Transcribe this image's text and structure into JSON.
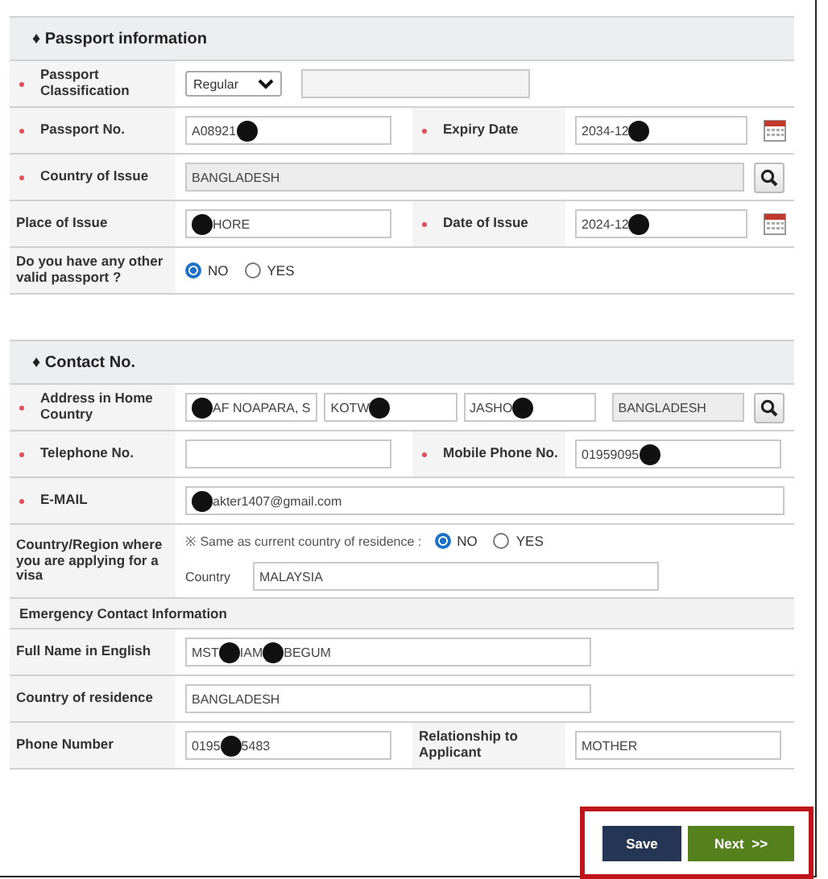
{
  "sections": [
    {
      "title": "♦ Passport information",
      "kind": "main",
      "rows": [
        {
          "kind": "fields",
          "fields": [
            {
              "label": "Passport Classification",
              "required": true,
              "lines": [
                [
                  {
                    "kind": "select",
                    "value": "Regular"
                  },
                  {
                    "kind": "text",
                    "readonly": true
                  }
                ]
              ]
            }
          ]
        },
        {
          "kind": "fields",
          "fields": [
            {
              "label": "Passport No.",
              "required": true,
              "lines": [
                [
                  {
                    "kind": "text",
                    "readonly": false,
                    "value": [
                      {
                        "text": "A08921"
                      },
                      {
                        "kind": "redaction"
                      }
                    ]
                  }
                ]
              ]
            },
            {
              "label": "Expiry Date",
              "required": true,
              "lines": [
                [
                  {
                    "kind": "text",
                    "readonly": false,
                    "value": [
                      {
                        "text": "2034-12"
                      },
                      {
                        "kind": "redaction"
                      }
                    ]
                  },
                  {
                    "kind": "calendar-button"
                  }
                ]
              ]
            }
          ]
        },
        {
          "kind": "fields",
          "fields": [
            {
              "label": "Country of Issue",
              "required": true,
              "lines": [
                [
                  {
                    "kind": "text",
                    "readonly": true,
                    "value": [
                      {
                        "text": "BANGLADESH"
                      }
                    ]
                  },
                  {
                    "kind": "search-button"
                  }
                ]
              ]
            }
          ]
        },
        {
          "kind": "fields",
          "fields": [
            {
              "label": "Place of Issue",
              "required": false,
              "lines": [
                [
                  {
                    "kind": "text",
                    "readonly": false,
                    "value": [
                      {
                        "kind": "redaction"
                      },
                      {
                        "text": "HORE"
                      }
                    ]
                  }
                ]
              ]
            },
            {
              "label": "Date of Issue",
              "required": true,
              "lines": [
                [
                  {
                    "kind": "text",
                    "readonly": false,
                    "value": [
                      {
                        "text": "2024-12"
                      },
                      {
                        "kind": "redaction"
                      }
                    ]
                  },
                  {
                    "kind": "calendar-button"
                  }
                ]
              ]
            }
          ]
        },
        {
          "kind": "fields",
          "fields": [
            {
              "label": "Do you have any other valid passport ?",
              "required": false,
              "lines": [
                [
                  {
                    "kind": "radio",
                    "options": [
                      {
                        "label": "NO",
                        "selected": true
                      },
                      {
                        "label": "YES",
                        "selected": false
                      }
                    ]
                  }
                ]
              ]
            }
          ]
        }
      ]
    },
    {
      "title": "♦ Contact No.",
      "kind": "main",
      "rows": [
        {
          "kind": "fields",
          "fields": [
            {
              "label": "Address in Home Country",
              "required": true,
              "lines": [
                [
                  {
                    "kind": "text",
                    "readonly": false,
                    "value": [
                      {
                        "kind": "redaction"
                      },
                      {
                        "text": "AF NOAPARA, S"
                      }
                    ]
                  },
                  {
                    "kind": "text",
                    "readonly": false,
                    "value": [
                      {
                        "text": "KOTW"
                      },
                      {
                        "kind": "redaction"
                      }
                    ]
                  },
                  {
                    "kind": "text",
                    "readonly": false,
                    "value": [
                      {
                        "text": "JASHO"
                      },
                      {
                        "kind": "redaction"
                      }
                    ]
                  },
                  {
                    "kind": "text",
                    "readonly": true,
                    "value": [
                      {
                        "text": "BANGLADESH"
                      }
                    ]
                  },
                  {
                    "kind": "search-button"
                  }
                ]
              ]
            }
          ]
        },
        {
          "kind": "fields",
          "fields": [
            {
              "label": "Telephone No.",
              "required": true,
              "lines": [
                [
                  {
                    "kind": "text",
                    "readonly": false
                  }
                ]
              ]
            },
            {
              "label": "Mobile Phone No.",
              "required": true,
              "lines": [
                [
                  {
                    "kind": "text",
                    "readonly": false,
                    "value": [
                      {
                        "text": "01959095"
                      },
                      {
                        "kind": "redaction"
                      }
                    ]
                  }
                ]
              ]
            }
          ]
        },
        {
          "kind": "fields",
          "fields": [
            {
              "label": "E-MAIL",
              "required": true,
              "lines": [
                [
                  {
                    "kind": "text",
                    "readonly": false,
                    "value": [
                      {
                        "kind": "redaction"
                      },
                      {
                        "text": "akter1407@gmail.com"
                      }
                    ]
                  }
                ]
              ]
            }
          ]
        },
        {
          "kind": "fields",
          "fields": [
            {
              "label": "Country/Region where you are applying for a visa",
              "required": false,
              "lines": [
                [
                  {
                    "kind": "note",
                    "text": "※ Same as current country of residence :"
                  },
                  {
                    "kind": "radio",
                    "options": [
                      {
                        "label": "NO",
                        "selected": true
                      },
                      {
                        "label": "YES",
                        "selected": false
                      }
                    ]
                  }
                ],
                [
                  {
                    "kind": "sublabel",
                    "text": "Country"
                  },
                  {
                    "kind": "text",
                    "readonly": false,
                    "value": [
                      {
                        "text": "MALAYSIA"
                      }
                    ]
                  }
                ]
              ]
            }
          ]
        }
      ]
    },
    {
      "title": "Emergency Contact Information",
      "kind": "sub",
      "rows": [
        {
          "kind": "fields",
          "fields": [
            {
              "label": "Full Name in English",
              "required": false,
              "lines": [
                [
                  {
                    "kind": "text",
                    "readonly": false,
                    "value": [
                      {
                        "text": "MST "
                      },
                      {
                        "kind": "redaction"
                      },
                      {
                        "text": "IAM"
                      },
                      {
                        "kind": "redaction"
                      },
                      {
                        "text": " BEGUM"
                      }
                    ]
                  }
                ]
              ]
            }
          ]
        },
        {
          "kind": "fields",
          "fields": [
            {
              "label": "Country of residence",
              "required": false,
              "lines": [
                [
                  {
                    "kind": "text",
                    "readonly": false,
                    "value": [
                      {
                        "text": "BANGLADESH"
                      }
                    ]
                  }
                ]
              ]
            }
          ]
        },
        {
          "kind": "fields",
          "fields": [
            {
              "label": "Phone Number",
              "required": false,
              "lines": [
                [
                  {
                    "kind": "text",
                    "readonly": false,
                    "value": [
                      {
                        "text": "0195"
                      },
                      {
                        "kind": "redaction"
                      },
                      {
                        "text": "5483"
                      }
                    ]
                  }
                ]
              ]
            },
            {
              "label": "Relationship to Applicant",
              "required": false,
              "lines": [
                [
                  {
                    "kind": "text",
                    "readonly": false,
                    "value": [
                      {
                        "text": "MOTHER"
                      }
                    ]
                  }
                ]
              ]
            }
          ]
        }
      ]
    }
  ],
  "buttons": [
    {
      "label": "Save",
      "kind": "save"
    },
    {
      "label": "Next  >>",
      "kind": "next"
    }
  ]
}
